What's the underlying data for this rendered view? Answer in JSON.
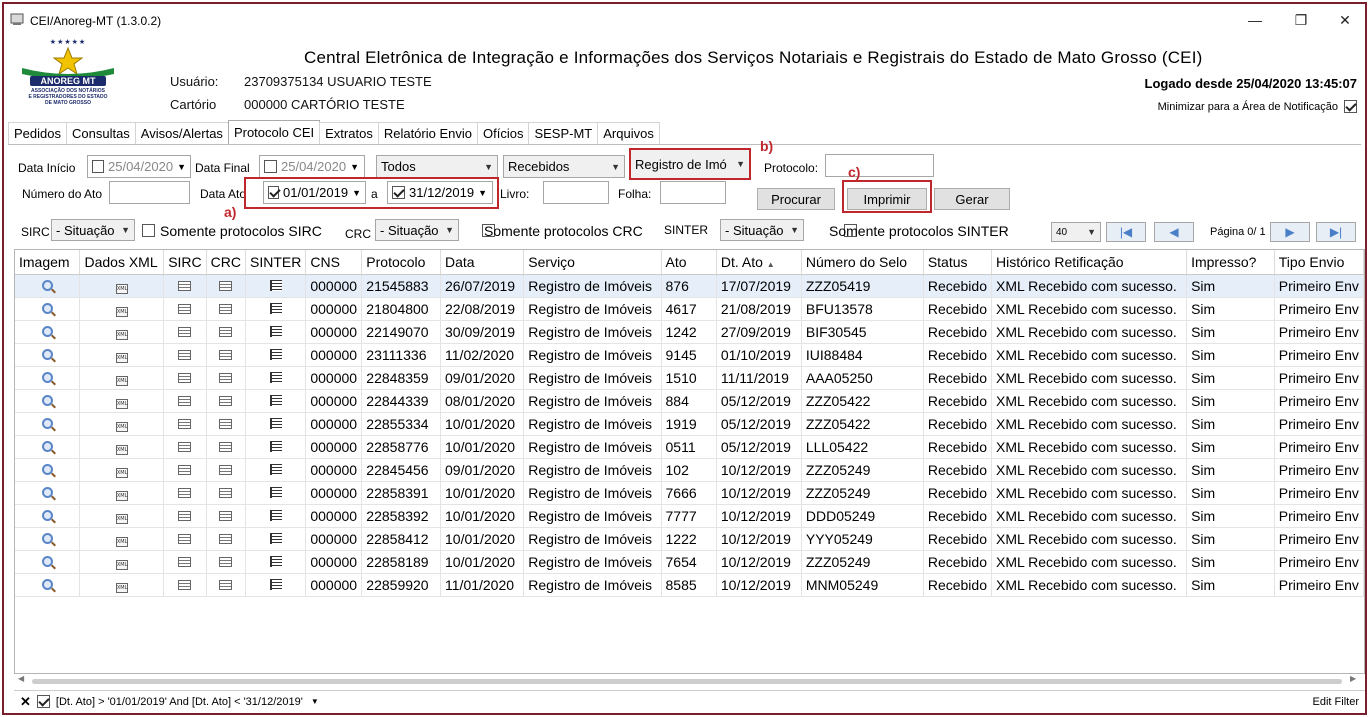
{
  "window": {
    "title": "CEI/Anoreg-MT (1.3.0.2)",
    "minimize": "—",
    "restore": "❐",
    "close": "✕"
  },
  "logo": {
    "stars": "★★★★★",
    "name": "ANOREG MT",
    "subtitle1": "ASSOCIAÇÃO DOS NOTÁRIOS",
    "subtitle2": "E REGISTRADORES DO ESTADO",
    "subtitle3": "DE MATO GROSSO"
  },
  "header": {
    "title": "Central Eletrônica de Integração e Informações dos Serviços Notariais e Registrais do Estado de Mato Grosso (CEI)",
    "user_label": "Usuário:",
    "user_value": "23709375134 USUARIO TESTE",
    "office_label": "Cartório",
    "office_value": "000000 CARTÓRIO TESTE",
    "logged": "Logado desde 25/04/2020 13:45:07",
    "minimize_tray": "Minimizar para a Área de Notificação"
  },
  "tabs": [
    "Pedidos",
    "Consultas",
    "Avisos/Alertas",
    "Protocolo CEI",
    "Extratos",
    "Relatório Envio",
    "Ofícios",
    "SESP-MT",
    "Arquivos"
  ],
  "filters": {
    "data_inicio_label": "Data Início",
    "data_inicio": "25/04/2020",
    "data_final_label": "Data Final",
    "data_final": "25/04/2020",
    "todos": "Todos",
    "recebidos": "Recebidos",
    "servico": "Registro de Imó",
    "protocolo_label": "Protocolo:",
    "protocolo_value": "",
    "numero_ato_label": "Número do Ato",
    "numero_ato_value": "",
    "data_ato_label": "Data Ato",
    "data_ato_de": "01/01/2019",
    "data_ato_sep": "a",
    "data_ato_ate": "31/12/2019",
    "livro_label": "Livro:",
    "folha_label": "Folha:",
    "procurar": "Procurar",
    "imprimir": "Imprimir",
    "gerar": "Gerar",
    "sirc_label": "SIRC",
    "sirc_situacao": "- Situação",
    "sirc_only": "Somente protocolos SIRC",
    "crc_label": "CRC",
    "crc_situacao": "- Situação",
    "crc_only": "Somente protocolos CRC",
    "sinter_label": "SINTER",
    "sinter_situacao": "- Situação",
    "sinter_only": "Somente protocolos SINTER",
    "page_size": "40",
    "pagina": "Página 0/ 1"
  },
  "annotations": {
    "a": "a)",
    "b": "b)",
    "c": "c)"
  },
  "table": {
    "columns": [
      "Imagem",
      "Dados XML",
      "SIRC",
      "CRC",
      "SINTER",
      "CNS",
      "Protocolo",
      "Data",
      "Serviço",
      "Ato",
      "Dt. Ato",
      "Número do Selo",
      "Status",
      "Histórico Retificação",
      "Impresso?",
      "Tipo Envio"
    ],
    "sort_arrow": "▲",
    "rows": [
      [
        "000000",
        "21545883",
        "26/07/2019",
        "Registro de Imóveis",
        "876",
        "17/07/2019",
        "ZZZ05419",
        "Recebido",
        "XML Recebido com sucesso.",
        "Sim",
        "Primeiro Env"
      ],
      [
        "000000",
        "21804800",
        "22/08/2019",
        "Registro de Imóveis",
        "4617",
        "21/08/2019",
        "BFU13578",
        "Recebido",
        "XML Recebido com sucesso.",
        "Sim",
        "Primeiro Env"
      ],
      [
        "000000",
        "22149070",
        "30/09/2019",
        "Registro de Imóveis",
        "1242",
        "27/09/2019",
        "BIF30545",
        "Recebido",
        "XML Recebido com sucesso.",
        "Sim",
        "Primeiro Env"
      ],
      [
        "000000",
        "23111336",
        "11/02/2020",
        "Registro de Imóveis",
        "9145",
        "01/10/2019",
        "IUI88484",
        "Recebido",
        "XML Recebido com sucesso.",
        "Sim",
        "Primeiro Env"
      ],
      [
        "000000",
        "22848359",
        "09/01/2020",
        "Registro de Imóveis",
        "1510",
        "11/11/2019",
        "AAA05250",
        "Recebido",
        "XML Recebido com sucesso.",
        "Sim",
        "Primeiro Env"
      ],
      [
        "000000",
        "22844339",
        "08/01/2020",
        "Registro de Imóveis",
        "884",
        "05/12/2019",
        "ZZZ05422",
        "Recebido",
        "XML Recebido com sucesso.",
        "Sim",
        "Primeiro Env"
      ],
      [
        "000000",
        "22855334",
        "10/01/2020",
        "Registro de Imóveis",
        "1919",
        "05/12/2019",
        "ZZZ05422",
        "Recebido",
        "XML Recebido com sucesso.",
        "Sim",
        "Primeiro Env"
      ],
      [
        "000000",
        "22858776",
        "10/01/2020",
        "Registro de Imóveis",
        "0511",
        "05/12/2019",
        "LLL05422",
        "Recebido",
        "XML Recebido com sucesso.",
        "Sim",
        "Primeiro Env"
      ],
      [
        "000000",
        "22845456",
        "09/01/2020",
        "Registro de Imóveis",
        "102",
        "10/12/2019",
        "ZZZ05249",
        "Recebido",
        "XML Recebido com sucesso.",
        "Sim",
        "Primeiro Env"
      ],
      [
        "000000",
        "22858391",
        "10/01/2020",
        "Registro de Imóveis",
        "7666",
        "10/12/2019",
        "ZZZ05249",
        "Recebido",
        "XML Recebido com sucesso.",
        "Sim",
        "Primeiro Env"
      ],
      [
        "000000",
        "22858392",
        "10/01/2020",
        "Registro de Imóveis",
        "7777",
        "10/12/2019",
        "DDD05249",
        "Recebido",
        "XML Recebido com sucesso.",
        "Sim",
        "Primeiro Env"
      ],
      [
        "000000",
        "22858412",
        "10/01/2020",
        "Registro de Imóveis",
        "1222",
        "10/12/2019",
        "YYY05249",
        "Recebido",
        "XML Recebido com sucesso.",
        "Sim",
        "Primeiro Env"
      ],
      [
        "000000",
        "22858189",
        "10/01/2020",
        "Registro de Imóveis",
        "7654",
        "10/12/2019",
        "ZZZ05249",
        "Recebido",
        "XML Recebido com sucesso.",
        "Sim",
        "Primeiro Env"
      ],
      [
        "000000",
        "22859920",
        "11/01/2020",
        "Registro de Imóveis",
        "8585",
        "10/12/2019",
        "MNM05249",
        "Recebido",
        "XML Recebido com sucesso.",
        "Sim",
        "Primeiro Env"
      ]
    ]
  },
  "footer": {
    "filter_text": "[Dt. Ato] > '01/01/2019' And [Dt. Ato] < '31/12/2019'",
    "edit_filter": "Edit Filter"
  },
  "colors": {
    "accent_red": "#c0272d",
    "frame": "#7a1f2b",
    "selected_row": "#e5eef9"
  }
}
